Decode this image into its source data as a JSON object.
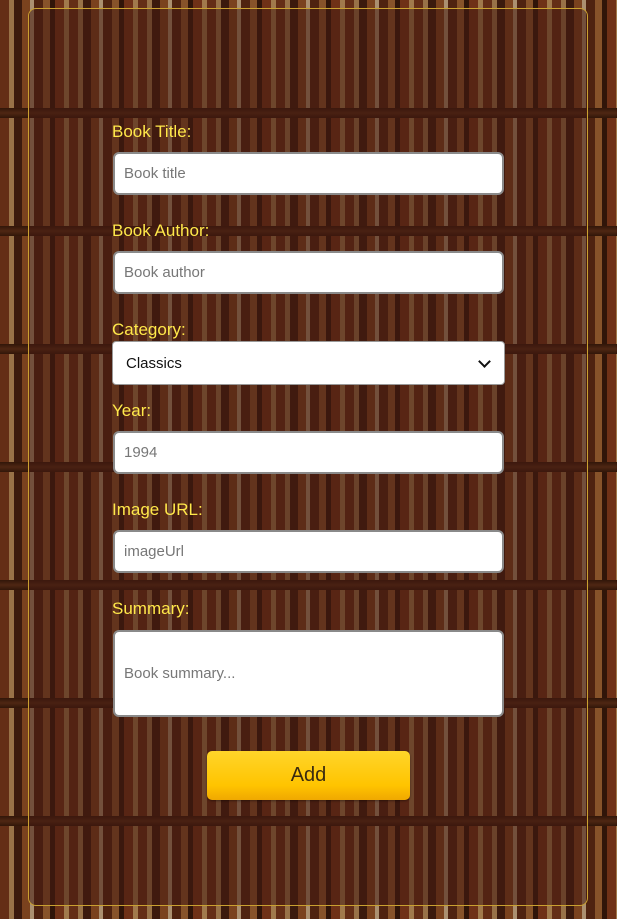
{
  "form": {
    "title_label": "Book Title:",
    "title_placeholder": "Book title",
    "author_label": "Book Author:",
    "author_placeholder": "Book author",
    "category_label": "Category:",
    "category_value": "Classics",
    "year_label": "Year:",
    "year_placeholder": "1994",
    "image_label": "Image URL:",
    "image_placeholder": "imageUrl",
    "summary_label": "Summary:",
    "summary_placeholder": "Book summary...",
    "submit_label": "Add"
  },
  "colors": {
    "label": "#ffe84a",
    "button": "#ffc400",
    "panel_border": "#c9a030"
  },
  "icons": {
    "select_chevron": "chevron-down-icon"
  }
}
